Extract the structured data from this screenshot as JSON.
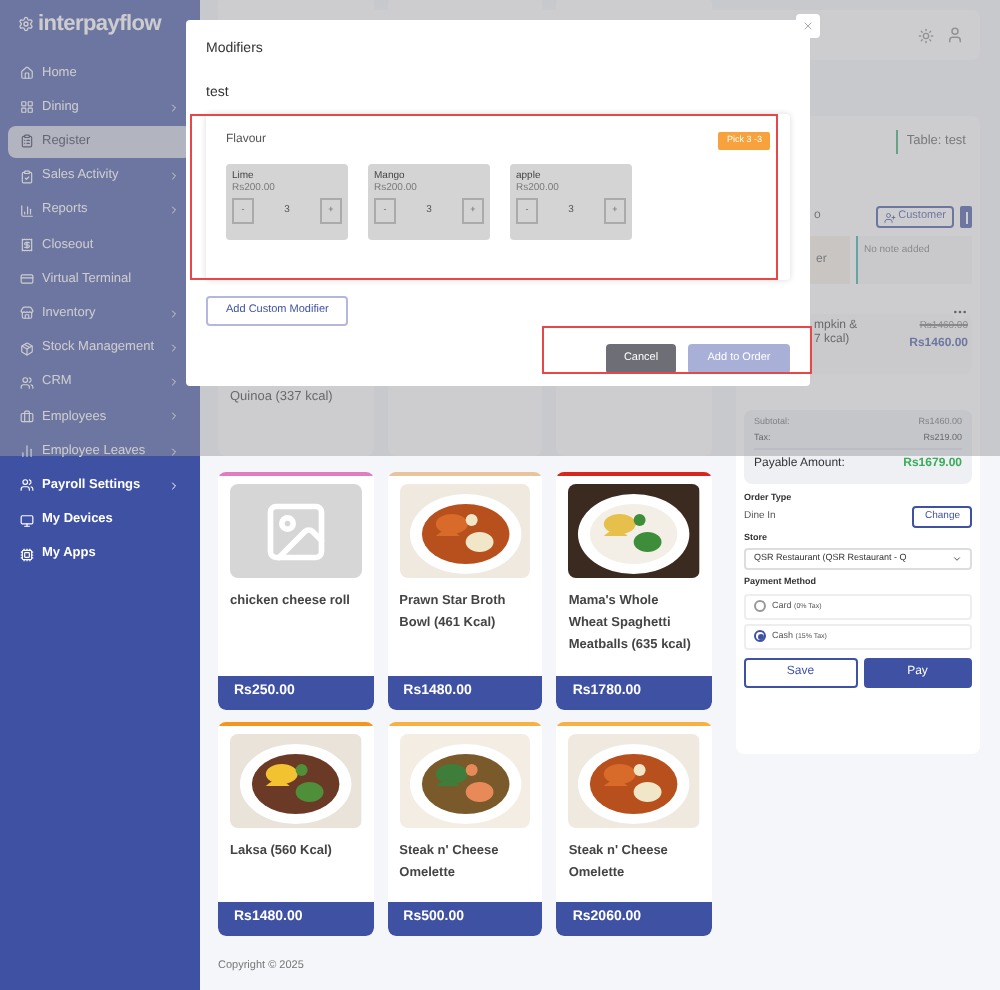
{
  "sidebar": {
    "logo": "interpayflow",
    "items": [
      {
        "label": "Home",
        "has_submenu": false,
        "selected": false
      },
      {
        "label": "Dining",
        "has_submenu": true,
        "selected": false
      },
      {
        "label": "Register",
        "has_submenu": false,
        "selected": true
      },
      {
        "label": "Sales Activity",
        "has_submenu": true,
        "selected": false
      },
      {
        "label": "Reports",
        "has_submenu": true,
        "selected": false
      },
      {
        "label": "Closeout",
        "has_submenu": false,
        "selected": false
      },
      {
        "label": "Virtual Terminal",
        "has_submenu": false,
        "selected": false
      },
      {
        "label": "Inventory",
        "has_submenu": true,
        "selected": false
      },
      {
        "label": "Stock Management",
        "has_submenu": true,
        "selected": false
      },
      {
        "label": "CRM",
        "has_submenu": true,
        "selected": false
      },
      {
        "label": "Employees",
        "has_submenu": true,
        "selected": false
      },
      {
        "label": "Employee Leaves",
        "has_submenu": true,
        "selected": false
      },
      {
        "label": "Payroll Settings",
        "has_submenu": true,
        "selected": false
      },
      {
        "label": "My Devices",
        "has_submenu": false,
        "selected": false
      },
      {
        "label": "My Apps",
        "has_submenu": false,
        "selected": false
      }
    ]
  },
  "modal": {
    "title": "Modifiers",
    "item": "test",
    "group": {
      "title": "Flavour",
      "badge": "Pick 3 -3",
      "options": [
        {
          "name": "Lime",
          "price": "Rs200.00",
          "quantity": "3",
          "decrement": "-",
          "increment": "+"
        },
        {
          "name": "Mango",
          "price": "Rs200.00",
          "quantity": "3",
          "decrement": "-",
          "increment": "+"
        },
        {
          "name": "apple",
          "price": "Rs200.00",
          "quantity": "3",
          "decrement": "-",
          "increment": "+"
        }
      ]
    },
    "custom_button": "Add Custom Modifier",
    "buttons": [
      {
        "label": "Cancel",
        "kind": "secondary",
        "disabled": false
      },
      {
        "label": "Add to Order",
        "kind": "primary",
        "disabled": true
      }
    ]
  },
  "partial_product": "Quinoa (337 kcal)",
  "products": [
    {
      "name": "chicken cheese roll",
      "price": "Rs250.00",
      "color": "#e07cc0",
      "kind": "placeholder"
    },
    {
      "name": "Prawn Star Broth Bowl (461 Kcal)",
      "price": "Rs1480.00",
      "color": "#e8c49a",
      "kind": "picture"
    },
    {
      "name": "Mama's Whole Wheat Spaghetti Meatballs (635 kcal)",
      "price": "Rs1780.00",
      "color": "#d9251c",
      "kind": "picture"
    },
    {
      "name": "Laksa (560 Kcal)",
      "price": "Rs1480.00",
      "color": "#f7941d",
      "kind": "picture"
    },
    {
      "name": "Steak n' Cheese Omelette",
      "price": "Rs500.00",
      "color": "#f9b042",
      "kind": "picture"
    },
    {
      "name": "Steak n' Cheese Omelette",
      "price": "Rs2060.00",
      "color": "#f9b042",
      "kind": "picture"
    }
  ],
  "order_panel": {
    "table": "Table: test",
    "partial_label": "o",
    "customer_button": "Customer",
    "note_tag": "er",
    "note": "No note added",
    "item": {
      "name_lines": [
        "mpkin &",
        "7 kcal)"
      ],
      "original_price": "Rs1460.00",
      "price": "Rs1460.00"
    },
    "summary": {
      "subtotal_label": "Subtotal:",
      "subtotal": "Rs1460.00",
      "tax_label": "Tax:",
      "tax": "Rs219.00",
      "payable_label": "Payable Amount:",
      "payable": "Rs1679.00"
    },
    "order_type": {
      "label": "Order Type",
      "value": "Dine In",
      "button": "Change"
    },
    "store": {
      "label": "Store",
      "value": "QSR Restaurant (QSR Restaurant - Q"
    },
    "payment": {
      "label": "Payment Method",
      "options": [
        {
          "label": "Card",
          "note": "(0% Tax)",
          "selected": false
        },
        {
          "label": "Cash",
          "note": "(15% Tax)",
          "selected": true
        }
      ]
    },
    "buttons": [
      {
        "label": "Save",
        "kind": "secondary"
      },
      {
        "label": "Pay",
        "kind": "primary"
      }
    ]
  },
  "footer": "Copyright © 2025"
}
